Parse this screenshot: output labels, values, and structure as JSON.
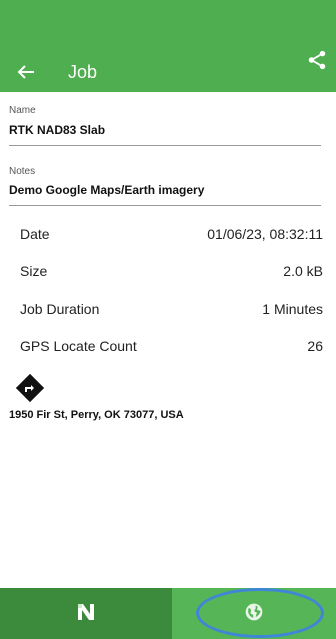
{
  "appbar": {
    "title": "Job",
    "back_icon": "arrow-left-icon",
    "share_icon": "share-icon"
  },
  "fields": [
    {
      "label": "Name",
      "value": "RTK NAD83 Slab"
    },
    {
      "label": "Notes",
      "value": "Demo Google Maps/Earth imagery"
    }
  ],
  "rows": [
    {
      "key": "Date",
      "value": "01/06/23, 08:32:11"
    },
    {
      "key": "Size",
      "value": "2.0 kB"
    },
    {
      "key": "Job Duration",
      "value": "1 Minutes"
    },
    {
      "key": "GPS Locate Count",
      "value": "26"
    }
  ],
  "location": {
    "icon": "directions-icon",
    "address": "1950 Fir St, Perry, OK 73077, USA"
  },
  "bottom_nav": [
    {
      "id": "logo",
      "icon": "n-logo-icon"
    },
    {
      "id": "globe",
      "icon": "globe-icon"
    }
  ],
  "colors": {
    "primary": "#4fae4f",
    "primary_dark": "#3c8a3c",
    "highlight_ring": "#3f86d9"
  }
}
